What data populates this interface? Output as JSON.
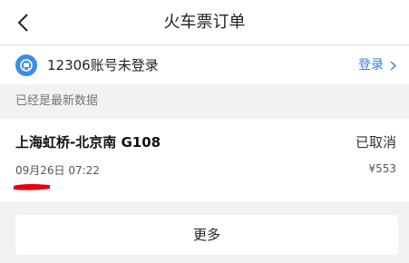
{
  "header": {
    "title": "火车票订单",
    "back_icon": "back-arrow-icon"
  },
  "account": {
    "logo_icon": "railway-logo-icon",
    "text": "12306账号未登录",
    "login_label": "登录",
    "login_icon": "chevron-right-icon",
    "accent_color": "#2f7fe8"
  },
  "status": {
    "text": "已经是最新数据"
  },
  "order": {
    "route": "上海虹桥-北京南 G108",
    "status": "已取消",
    "date": "09月26日 07:22",
    "price": "¥553",
    "redaction_color": "#e8000b"
  },
  "footer": {
    "more_label": "更多"
  }
}
